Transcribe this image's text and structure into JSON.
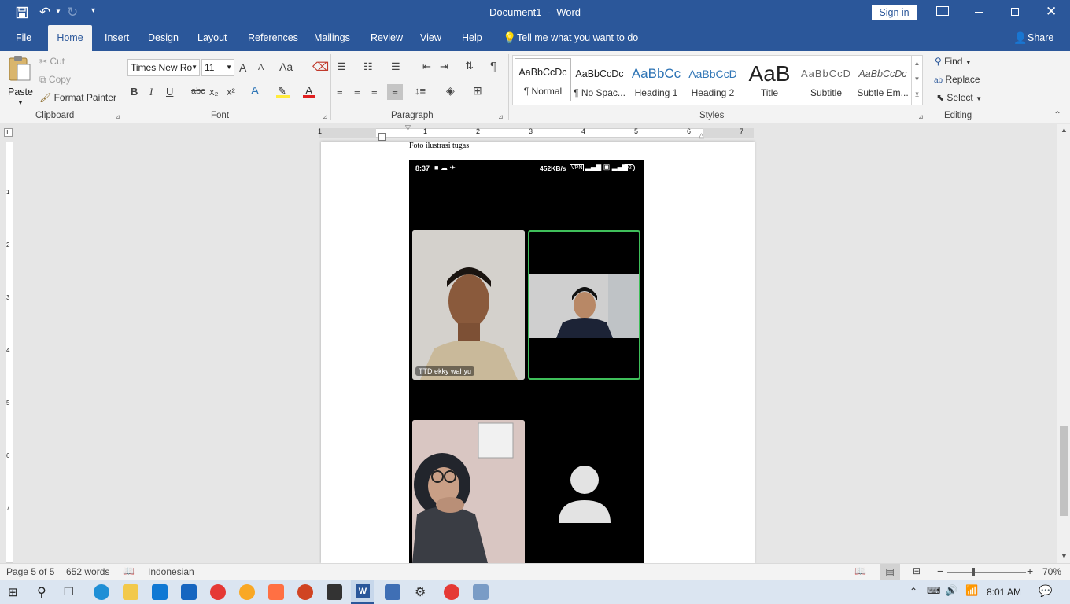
{
  "title_bar": {
    "doc_title": "Document1  -  Word",
    "sign_in": "Sign in"
  },
  "tabs": [
    {
      "label": "File"
    },
    {
      "label": "Home"
    },
    {
      "label": "Insert"
    },
    {
      "label": "Design"
    },
    {
      "label": "Layout"
    },
    {
      "label": "References"
    },
    {
      "label": "Mailings"
    },
    {
      "label": "Review"
    },
    {
      "label": "View"
    },
    {
      "label": "Help"
    }
  ],
  "tell_me": "Tell me what you want to do",
  "share": "Share",
  "clipboard": {
    "paste": "Paste",
    "cut": "Cut",
    "copy": "Copy",
    "format_painter": "Format Painter",
    "group": "Clipboard"
  },
  "font": {
    "name": "Times New Ro",
    "size": "11",
    "group": "Font",
    "grow": "A",
    "shrink": "A",
    "case": "Aa",
    "bold": "B",
    "italic": "I",
    "underline": "U",
    "strike": "abc",
    "sub": "x₂",
    "sup": "x²"
  },
  "paragraph": {
    "group": "Paragraph"
  },
  "styles": {
    "group": "Styles",
    "items": [
      {
        "preview": "AaBbCcDc",
        "name": "¶ Normal"
      },
      {
        "preview": "AaBbCcDc",
        "name": "¶ No Spac..."
      },
      {
        "preview": "AaBbCc",
        "name": "Heading 1"
      },
      {
        "preview": "AaBbCcD",
        "name": "Heading 2"
      },
      {
        "preview": "AaB",
        "name": "Title"
      },
      {
        "preview": "AaBbCcD",
        "name": "Subtitle"
      },
      {
        "preview": "AaBbCcDc",
        "name": "Subtle Em..."
      }
    ]
  },
  "editing": {
    "group": "Editing",
    "find": "Find",
    "replace": "Replace",
    "select": "Select"
  },
  "ruler": {
    "numbers": [
      "1",
      "1",
      "2",
      "3",
      "4",
      "5",
      "6",
      "7"
    ]
  },
  "vruler": {
    "numbers": [
      "1",
      "2",
      "3",
      "4",
      "5",
      "6",
      "7"
    ]
  },
  "document": {
    "caption": "Foto ilustrasi tugas",
    "phone_time": "8:37",
    "phone_speed": "452KB/s",
    "phone_vpn": "VPN",
    "phone_battery": "92",
    "participant_label": "TTD ekky wahyu"
  },
  "status": {
    "page": "Page 5 of 5",
    "words": "652 words",
    "language": "Indonesian",
    "zoom": "70%",
    "zoom_value": 70
  },
  "taskbar": {
    "time": "8:01 AM"
  },
  "colors": {
    "word_blue": "#2b579a",
    "active_speaker": "#3fbf5a"
  }
}
